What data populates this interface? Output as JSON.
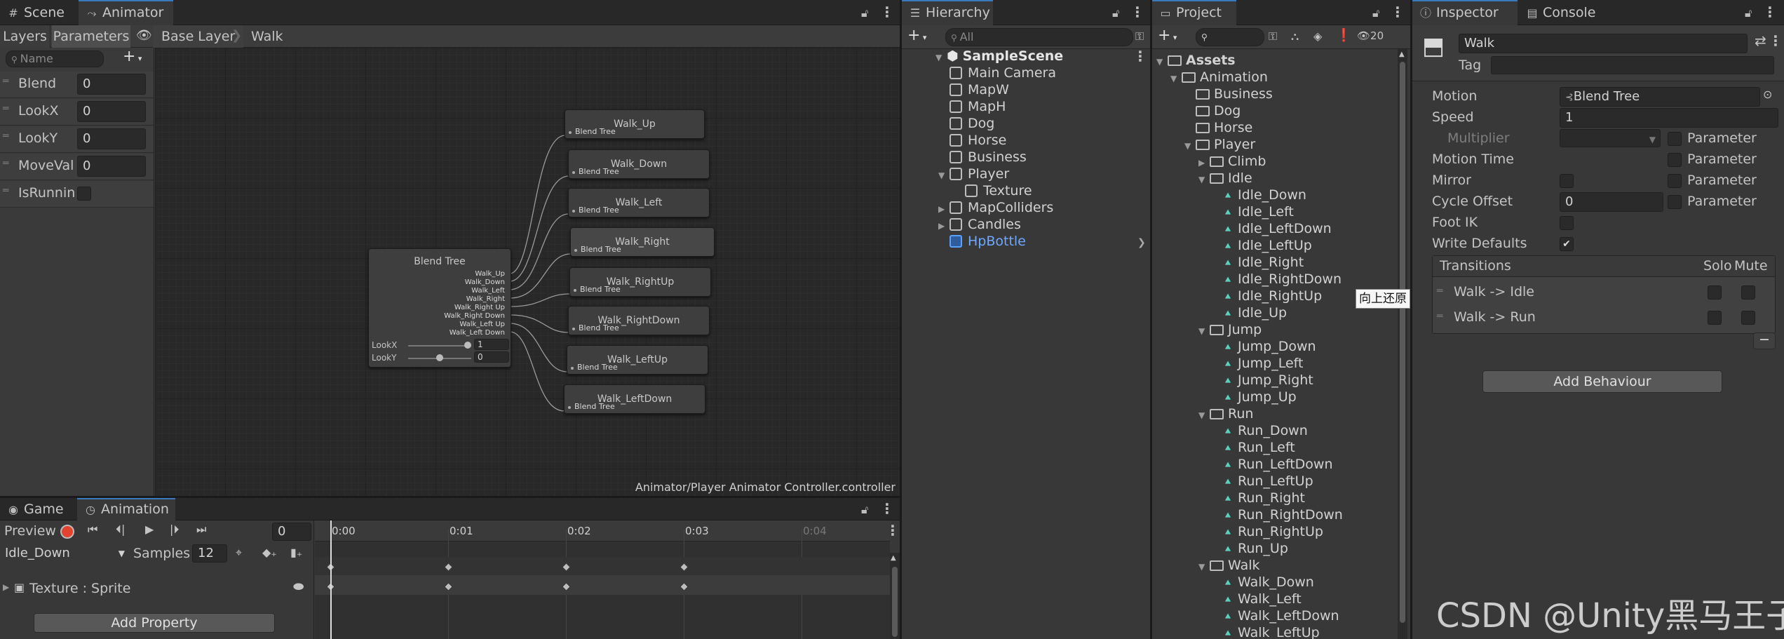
{
  "animator": {
    "tabs": [
      "Scene",
      "Animator"
    ],
    "subtabs": [
      "Layers",
      "Parameters"
    ],
    "breadcrumb": [
      "Base Layer",
      "Walk"
    ],
    "search_placeholder": "Name",
    "params": [
      {
        "name": "Blend",
        "value": "0"
      },
      {
        "name": "LookX",
        "value": "0"
      },
      {
        "name": "LookY",
        "value": "0"
      },
      {
        "name": "MoveValu",
        "value": "0"
      },
      {
        "name": "IsRunning",
        "value": ""
      }
    ],
    "blend_tree": {
      "title": "Blend Tree",
      "outputs": [
        "Walk_Up",
        "Walk_Down",
        "Walk_Left",
        "Walk_Right",
        "Walk_Right Up",
        "Walk_Right Down",
        "Walk_Left Up",
        "Walk_Left Down"
      ],
      "lookx_label": "LookX",
      "lookx_value": "1",
      "looky_label": "LookY",
      "looky_value": "0"
    },
    "nodes": [
      {
        "title": "Walk_Up",
        "sub": "Blend Tree"
      },
      {
        "title": "Walk_Down",
        "sub": "Blend Tree"
      },
      {
        "title": "Walk_Left",
        "sub": "Blend Tree"
      },
      {
        "title": "Walk_Right",
        "sub": "Blend Tree"
      },
      {
        "title": "Walk_RightUp",
        "sub": "Blend Tree"
      },
      {
        "title": "Walk_RightDown",
        "sub": "Blend Tree"
      },
      {
        "title": "Walk_LeftUp",
        "sub": "Blend Tree"
      },
      {
        "title": "Walk_LeftDown",
        "sub": "Blend Tree"
      }
    ],
    "footer_path": "Animator/Player Animator Controller.controller"
  },
  "animation": {
    "tabs": [
      "Game",
      "Animation"
    ],
    "preview_label": "Preview",
    "frame_value": "0",
    "clip": "Idle_Down",
    "samples_label": "Samples",
    "samples_value": "12",
    "ruler": [
      "0:00",
      "0:01",
      "0:02",
      "0:03",
      "0:04"
    ],
    "property": "Texture : Sprite",
    "add_property": "Add Property"
  },
  "hierarchy": {
    "tab": "Hierarchy",
    "search_placeholder": "All",
    "scene": "SampleScene",
    "items": [
      {
        "label": "Main Camera",
        "depth": 1,
        "arrow": ""
      },
      {
        "label": "MapW",
        "depth": 1,
        "arrow": ""
      },
      {
        "label": "MapH",
        "depth": 1,
        "arrow": ""
      },
      {
        "label": "Dog",
        "depth": 1,
        "arrow": ""
      },
      {
        "label": "Horse",
        "depth": 1,
        "arrow": ""
      },
      {
        "label": "Business",
        "depth": 1,
        "arrow": ""
      },
      {
        "label": "Player",
        "depth": 1,
        "arrow": "▼"
      },
      {
        "label": "Texture",
        "depth": 2,
        "arrow": ""
      },
      {
        "label": "MapColliders",
        "depth": 1,
        "arrow": "▶"
      },
      {
        "label": "Candles",
        "depth": 1,
        "arrow": "▶"
      },
      {
        "label": "HpBottle",
        "depth": 1,
        "arrow": ""
      }
    ]
  },
  "project": {
    "tab": "Project",
    "hidden_count": "20",
    "tooltip": "向上还原",
    "tree": [
      {
        "label": "Assets",
        "depth": 0,
        "arrow": "▼",
        "type": "folder",
        "bold": true
      },
      {
        "label": "Animation",
        "depth": 1,
        "arrow": "▼",
        "type": "folder"
      },
      {
        "label": "Business",
        "depth": 2,
        "arrow": "",
        "type": "folder"
      },
      {
        "label": "Dog",
        "depth": 2,
        "arrow": "",
        "type": "folder"
      },
      {
        "label": "Horse",
        "depth": 2,
        "arrow": "",
        "type": "folder"
      },
      {
        "label": "Player",
        "depth": 2,
        "arrow": "▼",
        "type": "folder"
      },
      {
        "label": "Climb",
        "depth": 3,
        "arrow": "▶",
        "type": "folder"
      },
      {
        "label": "Idle",
        "depth": 3,
        "arrow": "▼",
        "type": "folder"
      },
      {
        "label": "Idle_Down",
        "depth": 4,
        "arrow": "",
        "type": "anim"
      },
      {
        "label": "Idle_Left",
        "depth": 4,
        "arrow": "",
        "type": "anim"
      },
      {
        "label": "Idle_LeftDown",
        "depth": 4,
        "arrow": "",
        "type": "anim"
      },
      {
        "label": "Idle_LeftUp",
        "depth": 4,
        "arrow": "",
        "type": "anim"
      },
      {
        "label": "Idle_Right",
        "depth": 4,
        "arrow": "",
        "type": "anim"
      },
      {
        "label": "Idle_RightDown",
        "depth": 4,
        "arrow": "",
        "type": "anim"
      },
      {
        "label": "Idle_RightUp",
        "depth": 4,
        "arrow": "",
        "type": "anim"
      },
      {
        "label": "Idle_Up",
        "depth": 4,
        "arrow": "",
        "type": "anim"
      },
      {
        "label": "Jump",
        "depth": 3,
        "arrow": "▼",
        "type": "folder"
      },
      {
        "label": "Jump_Down",
        "depth": 4,
        "arrow": "",
        "type": "anim"
      },
      {
        "label": "Jump_Left",
        "depth": 4,
        "arrow": "",
        "type": "anim"
      },
      {
        "label": "Jump_Right",
        "depth": 4,
        "arrow": "",
        "type": "anim"
      },
      {
        "label": "Jump_Up",
        "depth": 4,
        "arrow": "",
        "type": "anim"
      },
      {
        "label": "Run",
        "depth": 3,
        "arrow": "▼",
        "type": "folder"
      },
      {
        "label": "Run_Down",
        "depth": 4,
        "arrow": "",
        "type": "anim"
      },
      {
        "label": "Run_Left",
        "depth": 4,
        "arrow": "",
        "type": "anim"
      },
      {
        "label": "Run_LeftDown",
        "depth": 4,
        "arrow": "",
        "type": "anim"
      },
      {
        "label": "Run_LeftUp",
        "depth": 4,
        "arrow": "",
        "type": "anim"
      },
      {
        "label": "Run_Right",
        "depth": 4,
        "arrow": "",
        "type": "anim"
      },
      {
        "label": "Run_RightDown",
        "depth": 4,
        "arrow": "",
        "type": "anim"
      },
      {
        "label": "Run_RightUp",
        "depth": 4,
        "arrow": "",
        "type": "anim"
      },
      {
        "label": "Run_Up",
        "depth": 4,
        "arrow": "",
        "type": "anim"
      },
      {
        "label": "Walk",
        "depth": 3,
        "arrow": "▼",
        "type": "folder"
      },
      {
        "label": "Walk_Down",
        "depth": 4,
        "arrow": "",
        "type": "anim"
      },
      {
        "label": "Walk_Left",
        "depth": 4,
        "arrow": "",
        "type": "anim"
      },
      {
        "label": "Walk_LeftDown",
        "depth": 4,
        "arrow": "",
        "type": "anim"
      },
      {
        "label": "Walk_LeftUp",
        "depth": 4,
        "arrow": "",
        "type": "anim"
      }
    ]
  },
  "inspector": {
    "tabs": [
      "Inspector",
      "Console"
    ],
    "name": "Walk",
    "tag_label": "Tag",
    "fields": {
      "motion_label": "Motion",
      "motion_value": "Blend Tree",
      "speed_label": "Speed",
      "speed_value": "1",
      "multiplier_label": "Multiplier",
      "motion_time_label": "Motion Time",
      "mirror_label": "Mirror",
      "cycle_offset_label": "Cycle Offset",
      "cycle_offset_value": "0",
      "foot_ik_label": "Foot IK",
      "write_defaults_label": "Write Defaults",
      "parameter_label": "Parameter"
    },
    "transitions_title": "Transitions",
    "solo_label": "Solo",
    "mute_label": "Mute",
    "transitions": [
      "Walk -> Idle",
      "Walk -> Run"
    ],
    "add_behaviour": "Add Behaviour"
  },
  "watermark": "CSDN @Unity黑马王子"
}
